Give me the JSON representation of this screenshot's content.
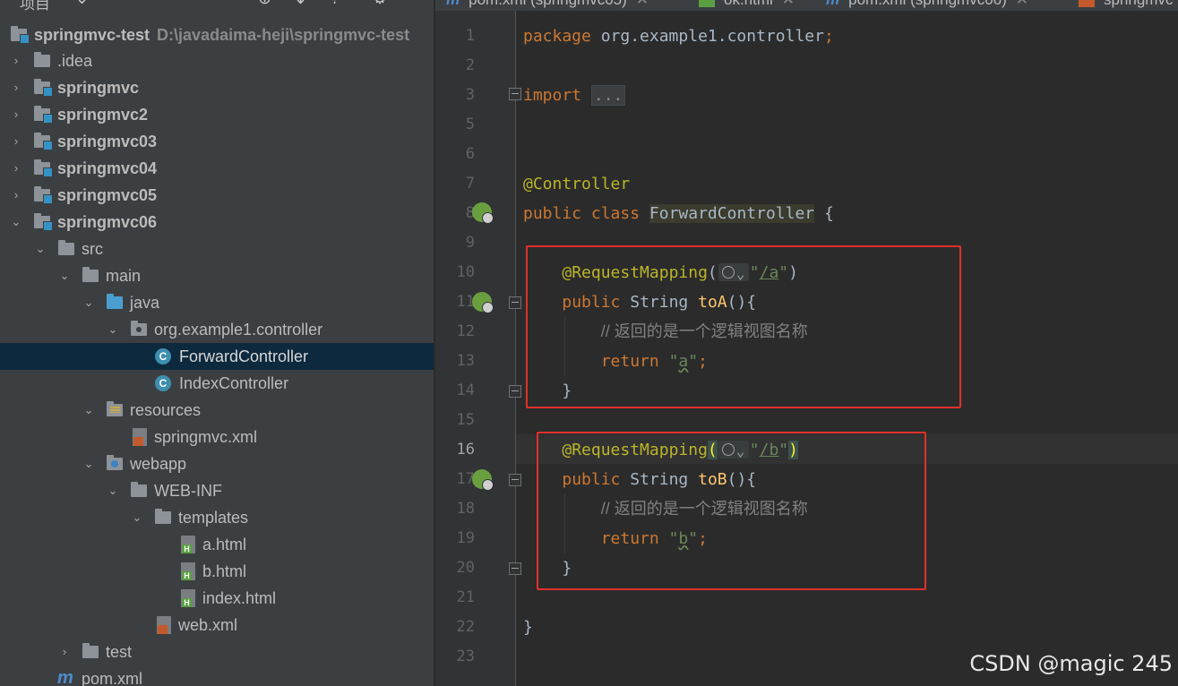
{
  "project_panel": {
    "title": "项目",
    "tree": [
      {
        "label": "springmvc-test",
        "path": "D:\\javadaima-heji\\springmvc-test",
        "icon": "module-folder-icon",
        "expanded": true
      },
      {
        "label": ".idea",
        "icon": "folder-icon",
        "expanded": false
      },
      {
        "label": "springmvc",
        "icon": "module-folder-icon",
        "expanded": false
      },
      {
        "label": "springmvc2",
        "icon": "module-folder-icon",
        "expanded": false
      },
      {
        "label": "springmvc03",
        "icon": "module-folder-icon",
        "expanded": false
      },
      {
        "label": "springmvc04",
        "icon": "module-folder-icon",
        "expanded": false
      },
      {
        "label": "springmvc05",
        "icon": "module-folder-icon",
        "expanded": false
      },
      {
        "label": "springmvc06",
        "icon": "module-folder-icon",
        "expanded": true
      },
      {
        "label": "src",
        "icon": "folder-icon",
        "expanded": true
      },
      {
        "label": "main",
        "icon": "folder-icon",
        "expanded": true
      },
      {
        "label": "java",
        "icon": "source-folder-icon",
        "expanded": true
      },
      {
        "label": "org.example1.controller",
        "icon": "package-icon",
        "expanded": true
      },
      {
        "label": "ForwardController",
        "icon": "java-class-icon",
        "selected": true
      },
      {
        "label": "IndexController",
        "icon": "java-class-icon"
      },
      {
        "label": "resources",
        "icon": "resources-folder-icon",
        "expanded": true
      },
      {
        "label": "springmvc.xml",
        "icon": "spring-xml-icon"
      },
      {
        "label": "webapp",
        "icon": "web-folder-icon",
        "expanded": true
      },
      {
        "label": "WEB-INF",
        "icon": "folder-icon",
        "expanded": true
      },
      {
        "label": "templates",
        "icon": "folder-icon",
        "expanded": true
      },
      {
        "label": "a.html",
        "icon": "html-file-icon"
      },
      {
        "label": "b.html",
        "icon": "html-file-icon"
      },
      {
        "label": "index.html",
        "icon": "html-file-icon"
      },
      {
        "label": "web.xml",
        "icon": "xml-file-icon"
      },
      {
        "label": "test",
        "icon": "folder-icon",
        "expanded": false
      },
      {
        "label": "pom.xml",
        "icon": "maven-icon"
      }
    ]
  },
  "tabs": [
    {
      "label": "pom.xml (springmvc05)",
      "icon": "maven-icon"
    },
    {
      "label": "ok.html",
      "icon": "html-file-icon"
    },
    {
      "label": "pom.xml (springmvc06)",
      "icon": "maven-icon"
    },
    {
      "label": "springmvc",
      "icon": "spring-xml-icon"
    }
  ],
  "editor": {
    "lines": [
      {
        "n": "1",
        "pkg_kw": "package",
        "pkg_name": "org.example1.controller",
        "semi": ";"
      },
      {
        "n": "2"
      },
      {
        "n": "3",
        "import_kw": "import",
        "folded": "..."
      },
      {
        "n": "5"
      },
      {
        "n": "6"
      },
      {
        "n": "7",
        "annotation": "@Controller"
      },
      {
        "n": "8",
        "kw1": "public",
        "kw2": "class",
        "class_name": "ForwardController",
        "brace": "{"
      },
      {
        "n": "9"
      },
      {
        "n": "10",
        "annotation": "@RequestMapping",
        "open": "(",
        "q1": "\"",
        "path": "/a",
        "q2": "\"",
        "close": ")"
      },
      {
        "n": "11",
        "kw1": "public",
        "type": "String",
        "method": "toA",
        "rest": "(){"
      },
      {
        "n": "12",
        "comment": "// 返回的是一个逻辑视图名称"
      },
      {
        "n": "13",
        "ret_kw": "return",
        "q1": "\"",
        "value": "a",
        "q2": "\"",
        "semi": ";"
      },
      {
        "n": "14",
        "brace": "}"
      },
      {
        "n": "15"
      },
      {
        "n": "16",
        "annotation": "@RequestMapping",
        "open": "(",
        "q1": "\"",
        "path": "/b",
        "q2": "\"",
        "close": ")"
      },
      {
        "n": "17",
        "kw1": "public",
        "type": "String",
        "method": "toB",
        "rest": "(){"
      },
      {
        "n": "18",
        "comment": "// 返回的是一个逻辑视图名称"
      },
      {
        "n": "19",
        "ret_kw": "return",
        "q1": "\"",
        "value": "b",
        "q2": "\"",
        "semi": ";"
      },
      {
        "n": "20",
        "brace": "}"
      },
      {
        "n": "21"
      },
      {
        "n": "22",
        "brace": "}"
      },
      {
        "n": "23"
      }
    ],
    "current_line": "16"
  },
  "watermark": "CSDN @magic 245",
  "colors": {
    "keyword": "#cc7832",
    "annotation": "#bbb529",
    "string": "#6a8759",
    "comment": "#808080",
    "method": "#ffc66d",
    "highlight_box": "#e0302a",
    "selection": "#0d293e"
  }
}
